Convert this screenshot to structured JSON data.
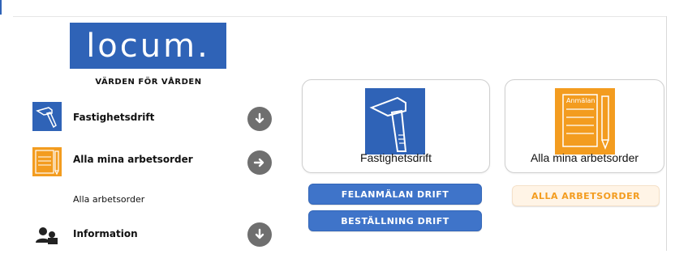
{
  "brand": {
    "logo_text": "locum.",
    "tagline": "VÄRDEN FÖR VÅRDEN"
  },
  "sidebar": {
    "items": [
      {
        "label": "Fastighetsdrift",
        "icon": "hammer-icon",
        "action_icon": "arrow-down-circle-icon"
      },
      {
        "label": "Alla mina arbetsorder",
        "icon": "work-order-icon",
        "action_icon": "arrow-right-circle-icon"
      },
      {
        "label": "Information",
        "icon": "users-icon",
        "action_icon": "arrow-down-circle-icon"
      }
    ],
    "sub_link": "Alla arbetsorder"
  },
  "cards": [
    {
      "label": "Fastighetsdrift",
      "icon": "hammer-icon"
    },
    {
      "label": "Alla mina arbetsorder",
      "icon": "work-order-icon",
      "icon_text": "Anmälan"
    }
  ],
  "buttons": {
    "felanmalan": "FELANMÄLAN DRIFT",
    "bestallning": "BESTÄLLNING DRIFT",
    "alla": "ALLA ARBETSORDER"
  },
  "colors": {
    "brand_blue": "#2f63b7",
    "button_blue": "#3f74c9",
    "orange": "#f39c1f",
    "gray_circle": "#6f6f6f"
  }
}
